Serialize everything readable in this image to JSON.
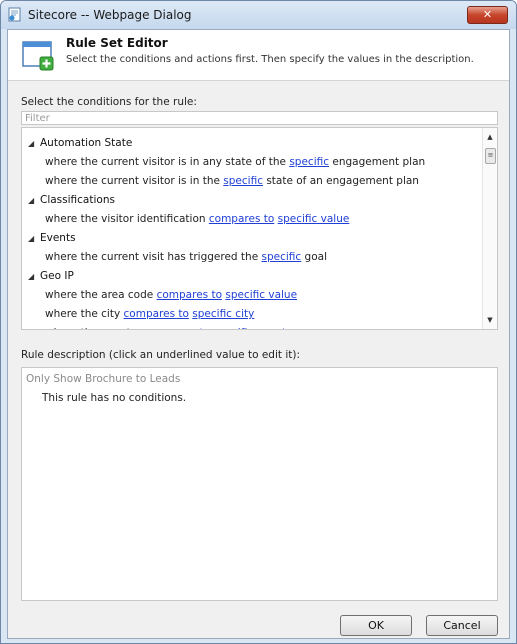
{
  "window": {
    "title": "Sitecore -- Webpage Dialog",
    "close_label": "✕"
  },
  "header": {
    "title": "Rule Set Editor",
    "subtitle": "Select the conditions and actions first. Then specify the values in the description."
  },
  "conditions": {
    "label": "Select the conditions for the rule:",
    "filter_placeholder": "Filter",
    "categories": [
      {
        "name": "Automation State",
        "items": [
          {
            "before": "where the current visitor is in any state of the ",
            "links": [
              "specific"
            ],
            "after": " engagement plan"
          },
          {
            "before": "where the current visitor is in the ",
            "links": [
              "specific"
            ],
            "after": " state of an engagement plan"
          }
        ]
      },
      {
        "name": "Classifications",
        "items": [
          {
            "before": "where the visitor identification ",
            "links": [
              "compares to",
              "specific value"
            ],
            "after": ""
          }
        ]
      },
      {
        "name": "Events",
        "items": [
          {
            "before": "where the current visit has triggered the ",
            "links": [
              "specific"
            ],
            "after": " goal"
          }
        ]
      },
      {
        "name": "Geo IP",
        "items": [
          {
            "before": "where the area code ",
            "links": [
              "compares to",
              "specific value"
            ],
            "after": ""
          },
          {
            "before": "where the city ",
            "links": [
              "compares to",
              "specific city"
            ],
            "after": ""
          },
          {
            "before": "where the country ",
            "links": [
              "compares to",
              "specific country"
            ],
            "after": ""
          }
        ]
      }
    ]
  },
  "description": {
    "label": "Rule description (click an underlined value to edit it):",
    "rule_name": "Only Show Brochure to Leads",
    "empty_text": "This rule has no conditions."
  },
  "buttons": {
    "ok": "OK",
    "cancel": "Cancel"
  }
}
